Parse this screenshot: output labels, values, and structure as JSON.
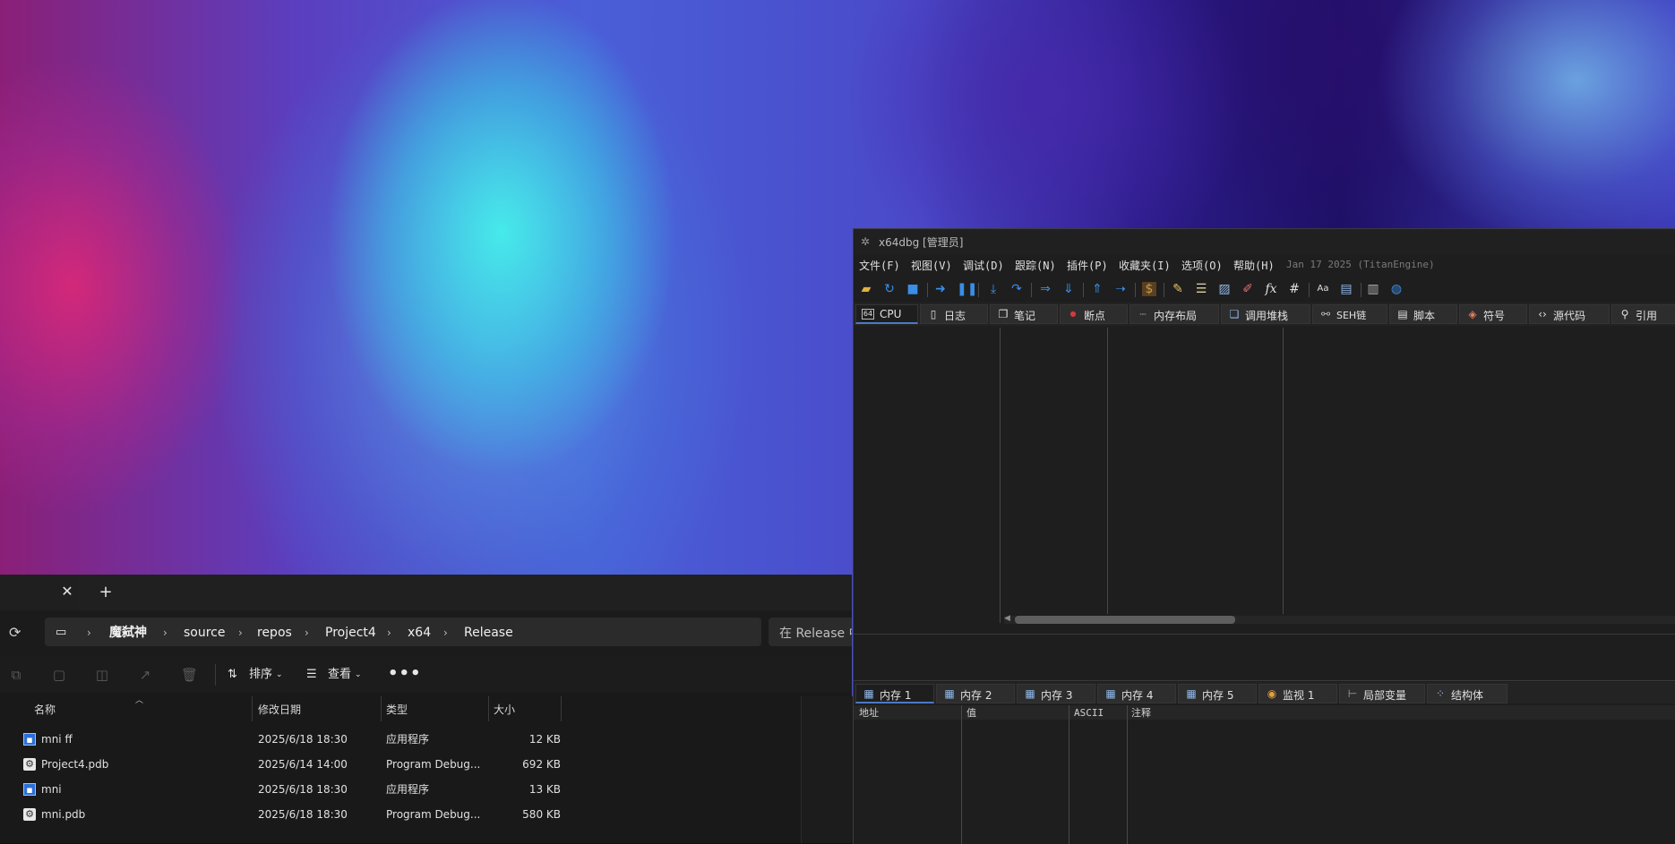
{
  "explorer": {
    "tab_close": "✕",
    "tab_new": "+",
    "breadcrumbs": [
      "魔弑神",
      "source",
      "repos",
      "Project4",
      "x64",
      "Release"
    ],
    "search_placeholder": "在 Release 中",
    "commands": {
      "sort": "排序",
      "view": "查看",
      "more": "•••"
    },
    "columns": {
      "name": "名称",
      "date": "修改日期",
      "type": "类型",
      "size": "大小"
    },
    "files": [
      {
        "name": "mni ff",
        "date": "2025/6/18 18:30",
        "type": "应用程序",
        "size": "12 KB",
        "icon": "exe"
      },
      {
        "name": "Project4.pdb",
        "date": "2025/6/14 14:00",
        "type": "Program Debug...",
        "size": "692 KB",
        "icon": "pdb"
      },
      {
        "name": "mni",
        "date": "2025/6/18 18:30",
        "type": "应用程序",
        "size": "13 KB",
        "icon": "exe"
      },
      {
        "name": "mni.pdb",
        "date": "2025/6/18 18:30",
        "type": "Program Debug...",
        "size": "580 KB",
        "icon": "pdb"
      }
    ]
  },
  "debugger": {
    "title": "x64dbg [管理员]",
    "menu": [
      "文件(F)",
      "视图(V)",
      "调试(D)",
      "跟踪(N)",
      "插件(P)",
      "收藏夹(I)",
      "选项(O)",
      "帮助(H)"
    ],
    "build_info": "Jan 17 2025 (TitanEngine)",
    "tabs": [
      "CPU",
      "日志",
      "笔记",
      "断点",
      "内存布局",
      "调用堆栈",
      "SEH链",
      "脚本",
      "符号",
      "源代码",
      "引用"
    ],
    "bottom_tabs": [
      "内存 1",
      "内存 2",
      "内存 3",
      "内存 4",
      "内存 5",
      "监视 1",
      "局部变量",
      "结构体"
    ],
    "dump_columns": [
      "地址",
      "值",
      "ASCII",
      "注释"
    ],
    "tab_icon_text": {
      "cpu": "64",
      "fx": "fx",
      "hash": "#",
      "az": "Aa"
    }
  },
  "colors": {
    "accent": "#4d79c7",
    "toolbar_blue": "#3a8ee6",
    "breakpoint_red": "#d23a3a"
  }
}
